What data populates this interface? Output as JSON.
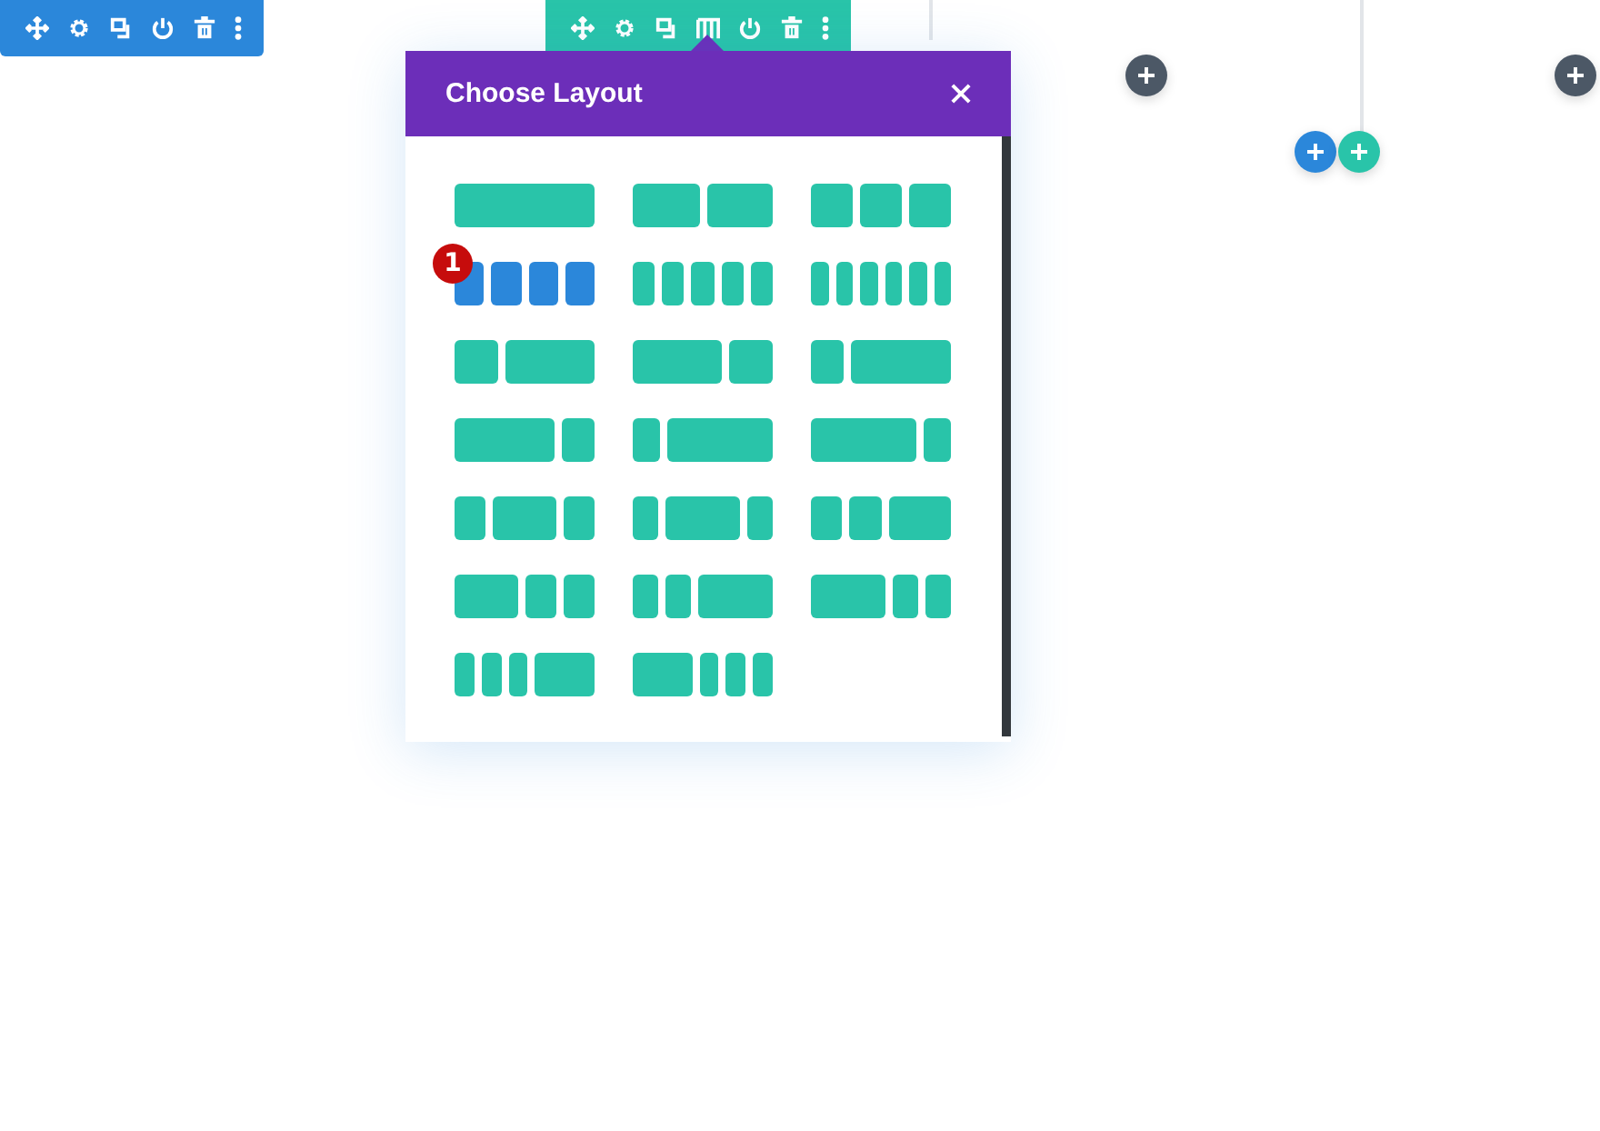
{
  "toolbars": [
    {
      "kind": "section"
    },
    {
      "kind": "row"
    }
  ],
  "add_buttons": [
    {
      "kind": "module"
    },
    {
      "kind": "module"
    },
    {
      "kind": "section"
    },
    {
      "kind": "row"
    }
  ],
  "modal": {
    "title": "Choose Layout",
    "badge": "1",
    "layouts": [
      {
        "kind": "full",
        "selected": false
      },
      {
        "kind": "halves",
        "selected": false
      },
      {
        "kind": "thirds",
        "selected": false
      },
      {
        "kind": "quarters",
        "selected": true
      },
      {
        "kind": "fifths",
        "selected": false
      },
      {
        "kind": "sixths",
        "selected": false
      },
      {
        "kind": "narrow-wide",
        "selected": false
      },
      {
        "kind": "wide-narrow",
        "selected": false
      },
      {
        "kind": "quarter-rest",
        "selected": false
      },
      {
        "kind": "rest-quarter",
        "selected": false
      },
      {
        "kind": "fifth-rest",
        "selected": false
      },
      {
        "kind": "rest-fifth",
        "selected": false
      },
      {
        "kind": "center-half",
        "selected": false
      },
      {
        "kind": "center-wide",
        "selected": false
      },
      {
        "kind": "two-small-wide",
        "selected": false
      },
      {
        "kind": "wide-two-small",
        "selected": false
      },
      {
        "kind": "two-narrow-wide",
        "selected": false
      },
      {
        "kind": "wide-two-narrow",
        "selected": false
      },
      {
        "kind": "three-narrow-wide",
        "selected": false
      },
      {
        "kind": "wide-three-narrow",
        "selected": false
      }
    ]
  }
}
